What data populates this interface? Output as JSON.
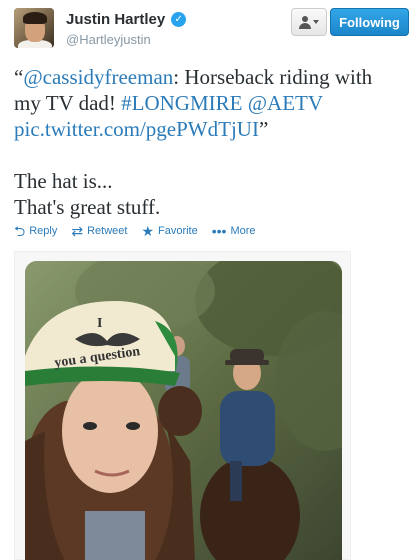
{
  "profile": {
    "display_name": "Justin Hartley",
    "handle": "@Hartleyjustin",
    "verified_glyph": "✓"
  },
  "header": {
    "follow_label": "Following"
  },
  "tweet": {
    "quote_open": "“",
    "mention": "@cassidyfreeman",
    "text_after_mention": ": Horseback riding with",
    "text_line2_prefix": "my TV dad! ",
    "hashtag": "#LONGMIRE",
    "mention2": "@AETV",
    "link": "pic.twitter.com/pgePWdTjUI",
    "quote_close": "”",
    "line4": "The hat is...",
    "line5": "That's great stuff."
  },
  "actions": {
    "reply": "Reply",
    "retweet": "Retweet",
    "favorite": "Favorite",
    "more": "More"
  },
  "photo": {
    "hat_text_top": "I",
    "hat_text_bottom": "you a question"
  },
  "icons": [
    "verified-badge-icon",
    "user-icon",
    "reply-icon",
    "retweet-icon",
    "star-icon",
    "more-dots-icon"
  ]
}
